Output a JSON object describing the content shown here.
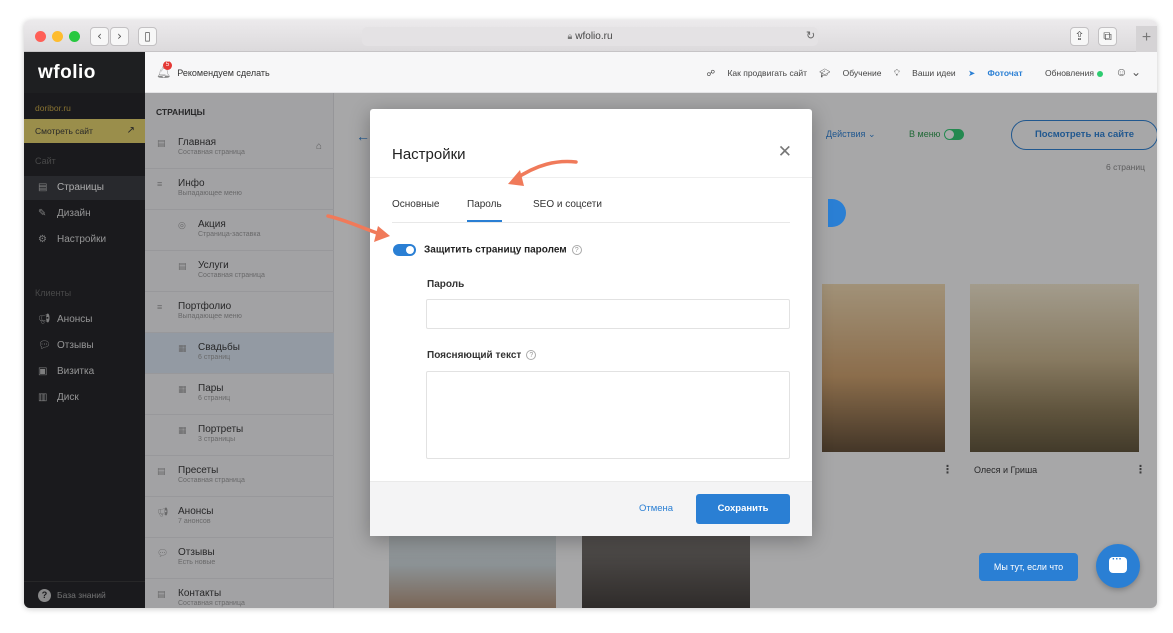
{
  "browser": {
    "url": "wfolio.ru",
    "back_icon": "chevron-left-icon",
    "forward_icon": "chevron-right-icon",
    "sidebar_icon": "sidebar-toggle-icon",
    "lock_icon": "lock-icon",
    "reload_icon": "reload-icon",
    "share_icon": "share-icon",
    "tabs_icon": "tabs-icon",
    "new_tab": "+"
  },
  "app": {
    "logo": "wfolio",
    "recommend": {
      "label": "Рекомендуем сделать",
      "badge": "5"
    },
    "top_links": {
      "promote": "Как продвигать сайт",
      "learn": "Обучение",
      "ideas": "Ваши идеи",
      "photochat": "Фоточат",
      "updates": "Обновления"
    }
  },
  "sidebar": {
    "site_name": "doribor.ru",
    "view_site": "Смотреть сайт",
    "section_site": "Сайт",
    "items_site": [
      {
        "label": "Страницы",
        "icon": "page-icon"
      },
      {
        "label": "Дизайн",
        "icon": "brush-icon"
      },
      {
        "label": "Настройки",
        "icon": "gear-icon"
      }
    ],
    "section_clients": "Клиенты",
    "items_clients": [
      {
        "label": "Анонсы",
        "icon": "megaphone-icon"
      },
      {
        "label": "Отзывы",
        "icon": "chat-icon"
      },
      {
        "label": "Визитка",
        "icon": "card-icon"
      },
      {
        "label": "Диск",
        "icon": "disk-icon"
      }
    ],
    "knowledge_base": "База знаний"
  },
  "pages_panel": {
    "title": "СТРАНИЦЫ",
    "items": [
      {
        "name": "Главная",
        "sub": "Составная страница"
      },
      {
        "name": "Инфо",
        "sub": "Выпадающее меню"
      },
      {
        "name": "Акция",
        "sub": "Страница-заставка"
      },
      {
        "name": "Услуги",
        "sub": "Составная страница"
      },
      {
        "name": "Портфолио",
        "sub": "Выпадающее меню"
      },
      {
        "name": "Свадьбы",
        "sub": "6 страниц"
      },
      {
        "name": "Пары",
        "sub": "6 страниц"
      },
      {
        "name": "Портреты",
        "sub": "3 страницы"
      },
      {
        "name": "Пресеты",
        "sub": "Составная страница"
      },
      {
        "name": "Анонсы",
        "sub": "7 анонсов"
      },
      {
        "name": "Отзывы",
        "sub": "Есть новые"
      },
      {
        "name": "Контакты",
        "sub": "Составная страница"
      }
    ]
  },
  "main": {
    "actions": "Действия",
    "in_menu": "В меню",
    "view_on_site": "Посмотреть на сайте",
    "pages_count": "6 страниц",
    "gallery": [
      {
        "caption": "Олеся и Гриша"
      }
    ]
  },
  "modal": {
    "title": "Настройки",
    "tabs": [
      "Основные",
      "Пароль",
      "SEO и соцсети"
    ],
    "active_tab": "Пароль",
    "protect_label": "Защитить страницу паролем",
    "protect_enabled": true,
    "password_label": "Пароль",
    "password_value": "",
    "explain_label": "Поясняющий текст",
    "explain_value": "",
    "cancel": "Отмена",
    "save": "Сохранить"
  },
  "chat": {
    "label": "Мы тут, если что"
  },
  "colors": {
    "accent": "#2a7fd4",
    "sidebar_bg": "#1e1f21",
    "view_site_bg": "#e6d36a",
    "annotation_arrow": "#f07a5a"
  }
}
